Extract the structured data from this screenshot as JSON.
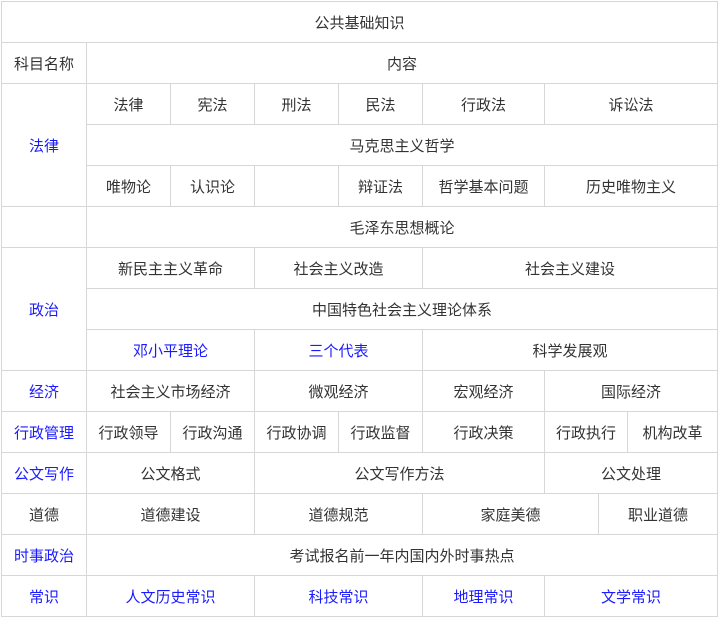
{
  "title": "公共基础知识",
  "header": {
    "subject": "科目名称",
    "content": "内容"
  },
  "colors": {
    "link": "#1a1aff",
    "text": "#333333",
    "border": "#d7d7d7"
  },
  "rows": {
    "law": {
      "subject": "法律",
      "items": [
        "法律",
        "宪法",
        "刑法",
        "民法",
        "行政法",
        "诉讼法"
      ]
    },
    "philosophy": {
      "heading": "马克思主义哲学",
      "items": [
        "唯物论",
        "认识论",
        "",
        "辩证法",
        "哲学基本问题",
        "历史唯物主义"
      ]
    },
    "mao": {
      "heading": "毛泽东思想概论"
    },
    "politics": {
      "subject": "政治",
      "items": [
        "新民主主义革命",
        "社会主义改造",
        "社会主义建设"
      ],
      "heading": "中国特色社会主义理论体系",
      "theory": [
        "邓小平理论",
        "三个代表",
        "科学发展观"
      ]
    },
    "economy": {
      "subject": "经济",
      "items": [
        "社会主义市场经济",
        "微观经济",
        "宏观经济",
        "国际经济"
      ]
    },
    "admin": {
      "subject": "行政管理",
      "items": [
        "行政领导",
        "行政沟通",
        "行政协调",
        "行政监督",
        "行政决策",
        "行政执行",
        "机构改革"
      ]
    },
    "writing": {
      "subject": "公文写作",
      "items": [
        "公文格式",
        "公文写作方法",
        "公文处理"
      ]
    },
    "morality": {
      "subject": "道德",
      "items": [
        "道德建设",
        "道德规范",
        "家庭美德",
        "职业道德"
      ]
    },
    "current": {
      "subject": "时事政治",
      "content": "考试报名前一年内国内外时事热点"
    },
    "common": {
      "subject": "常识",
      "items": [
        "人文历史常识",
        "科技常识",
        "地理常识",
        "文学常识"
      ]
    }
  }
}
